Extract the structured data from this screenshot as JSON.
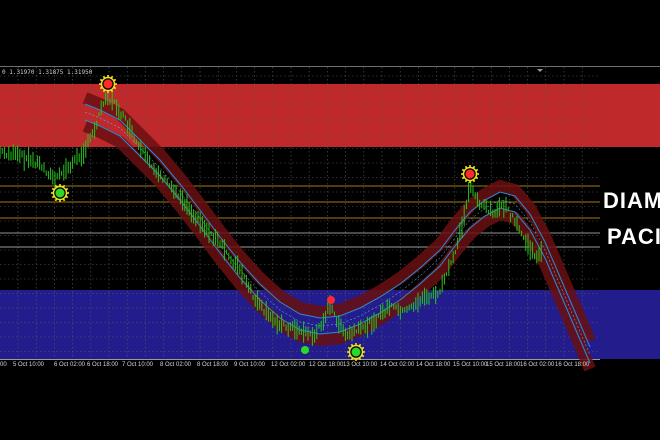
{
  "ohlc_text": "0 1.31970 1.31875 1.31950",
  "brand": {
    "line1": "DIAM",
    "line2": "PACI"
  },
  "x_labels": [
    "00",
    "5 Oct 10:00",
    "6 Oct 02:00",
    "6 Oct 18:00",
    "7 Oct 10:00",
    "8 Oct 02:00",
    "8 Oct 18:00",
    "9 Oct 10:00",
    "12 Oct 02:00",
    "12 Oct 18:00",
    "13 Oct 10:00",
    "14 Oct 02:00",
    "14 Oct 18:00",
    "15 Oct 10:00",
    "15 Oct 18:00",
    "16 Oct 02:00",
    "16 Oct 18:00"
  ],
  "colors": {
    "background": "#000000",
    "top_zone": "#c0292b",
    "bottom_zone": "#231c8c",
    "grid": "#5a5a5a",
    "candle": "#27c41d",
    "band_outer": "#6a0f12",
    "band_line": "#2a8ad6",
    "level_line": "#d9a321",
    "sell_signal": "#ff2a2a",
    "buy_signal": "#2bd92b",
    "signal_halo": "#f2e21a"
  },
  "signals": [
    {
      "type": "sell",
      "halo": true
    },
    {
      "type": "buy",
      "halo": true
    },
    {
      "type": "sell",
      "halo": false
    },
    {
      "type": "buy",
      "halo": false
    },
    {
      "type": "buy",
      "halo": true
    },
    {
      "type": "sell",
      "halo": true
    }
  ]
}
